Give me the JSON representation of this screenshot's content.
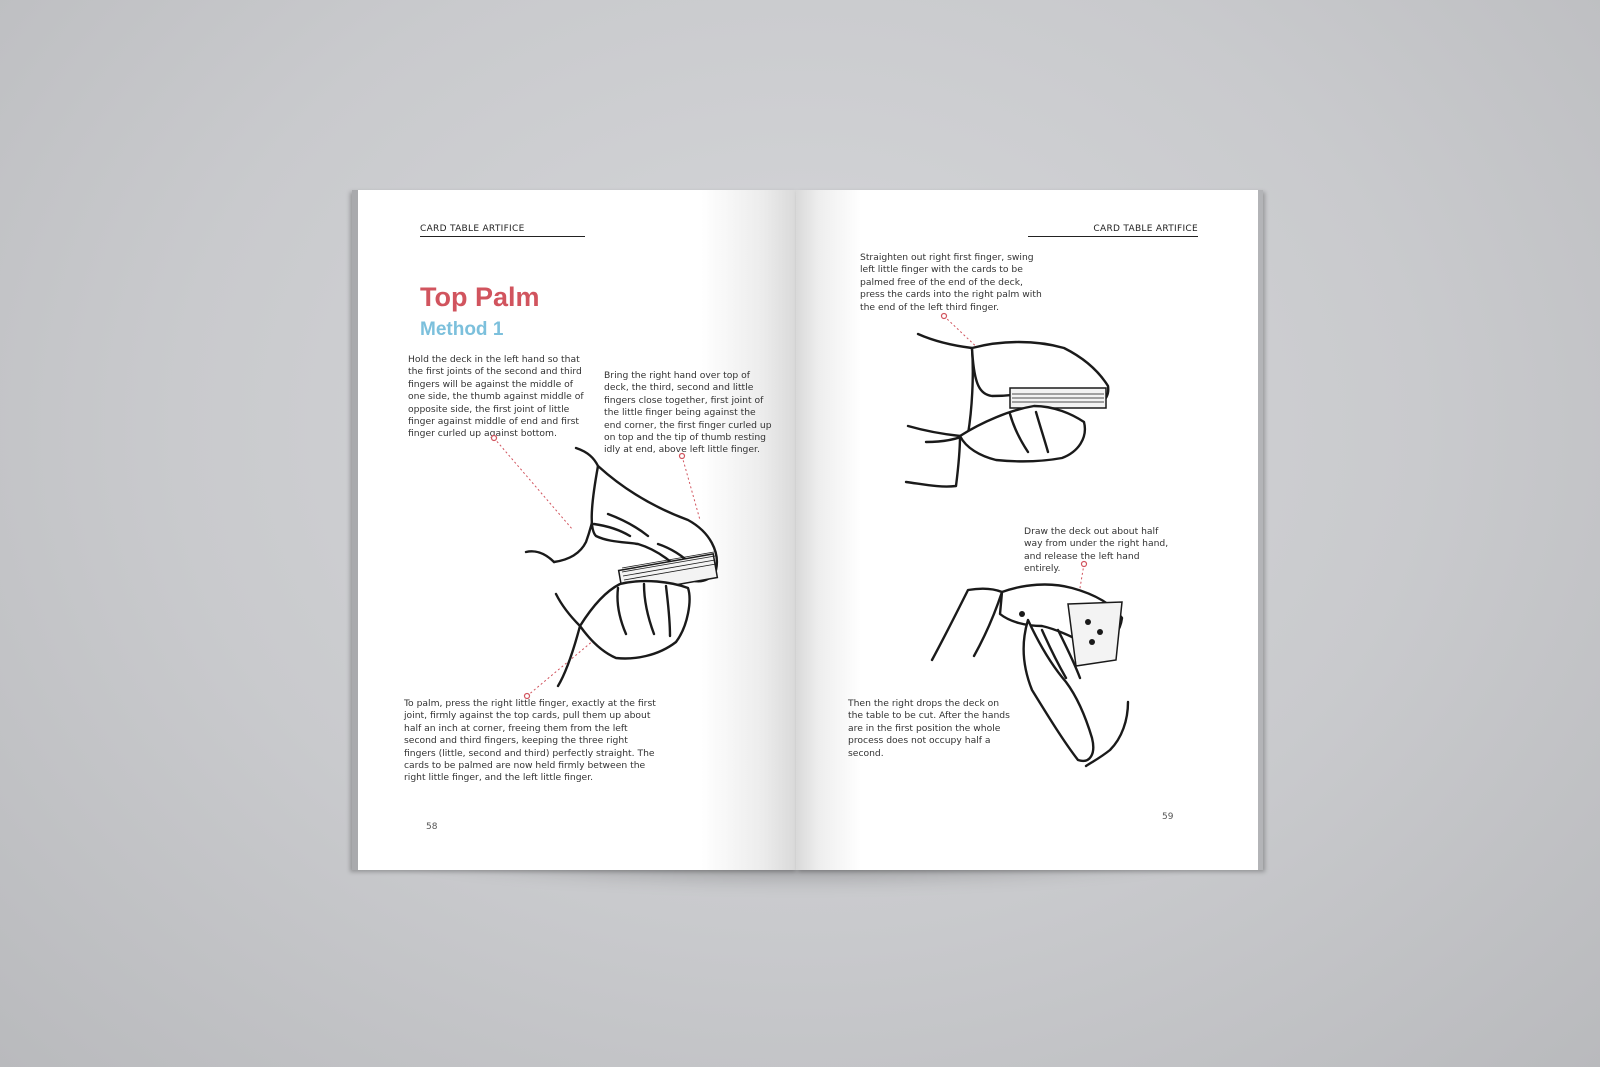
{
  "spread": {
    "left_page": {
      "running_head": "CARD TABLE ARTIFICE",
      "title": "Top Palm",
      "subtitle": "Method 1",
      "paragraphs": [
        "Hold the deck in the left hand so that the first joints of the second and third fingers will be against the middle of one side, the thumb against middle of opposite side, the first joint of little finger against middle of end and first finger curled up against bottom.",
        "Bring the right hand over top of deck, the third, second and little fingers close together, first joint of the little finger being against the end corner, the first finger curled up on top and the tip of thumb resting idly at end, above left little finger.",
        "To palm, press the right little finger, exactly at the first joint, firmly against the top cards, pull them up about half an inch at corner, freeing them from the left second and third fingers, keeping the three right fingers (little, second and third) perfectly straight. The cards to be palmed are now held firmly between the right little finger, and the left little finger."
      ],
      "page_number": "58"
    },
    "right_page": {
      "running_head": "CARD TABLE ARTIFICE",
      "paragraphs": [
        "Straighten out right first finger, swing left little finger with the cards to be palmed free of the end of the deck, press the cards into the right palm with the end of the left third finger.",
        "Draw the deck out about half way from under the right hand, and release the left hand entirely.",
        "Then the right drops the deck on the table to be cut. After the hands are in the first position the whole process does not occupy half a second."
      ],
      "page_number": "59"
    },
    "colors": {
      "title": "#d1545e",
      "subtitle": "#7cc0dc",
      "callout": "#d1545e",
      "background": "#c9cacd"
    },
    "illustrations": [
      "hands-holding-deck-illustration",
      "hands-palming-illustration",
      "hands-releasing-deck-illustration"
    ]
  }
}
